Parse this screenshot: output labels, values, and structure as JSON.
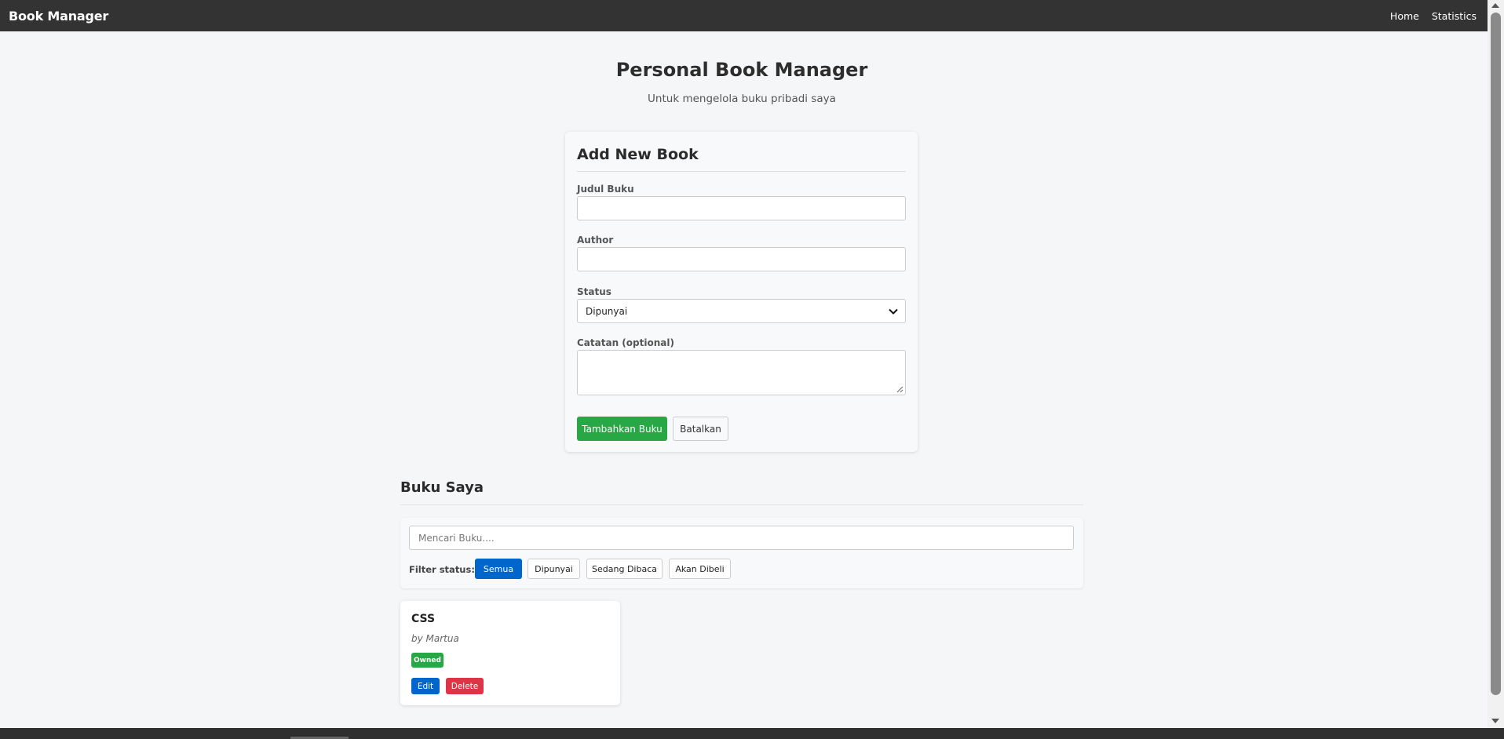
{
  "navbar": {
    "brand": "Book Manager",
    "links": [
      "Home",
      "Statistics"
    ]
  },
  "header": {
    "title": "Personal Book Manager",
    "subtitle": "Untuk mengelola buku pribadi saya"
  },
  "form": {
    "title": "Add New Book",
    "title_label": "Judul Buku",
    "title_value": "",
    "author_label": "Author",
    "author_value": "",
    "status_label": "Status",
    "status_value": "Dipunyai",
    "notes_label": "Catatan (optional)",
    "notes_value": "",
    "submit_label": "Tambahkan Buku",
    "cancel_label": "Batalkan"
  },
  "books_section": {
    "title": "Buku Saya",
    "search_placeholder": "Mencari Buku....",
    "filter_label": "Filter status:",
    "filters": [
      "Semua",
      "Dipunyai",
      "Sedang Dibaca",
      "Akan Dibeli"
    ],
    "active_filter": "Semua",
    "books": [
      {
        "title": "CSS",
        "author": "by Martua",
        "badge": "Owned",
        "edit_label": "Edit",
        "delete_label": "Delete"
      }
    ]
  },
  "colors": {
    "navbar": "#333333",
    "primary": "#0066cc",
    "success": "#28a745",
    "danger": "#dc3545"
  }
}
